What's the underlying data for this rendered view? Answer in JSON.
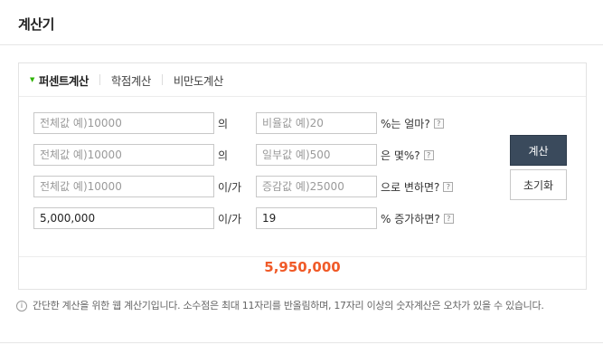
{
  "header": {
    "title": "계산기"
  },
  "tabs": [
    {
      "label": "퍼센트계산",
      "active": true
    },
    {
      "label": "학점계산",
      "active": false
    },
    {
      "label": "비만도계산",
      "active": false
    }
  ],
  "rows": [
    {
      "total_value": "",
      "total_placeholder": "전체값 예)10000",
      "connector": "의",
      "second_value": "",
      "second_placeholder": "비율값 예)20",
      "suffix": "%는 얼마?"
    },
    {
      "total_value": "",
      "total_placeholder": "전체값 예)10000",
      "connector": "의",
      "second_value": "",
      "second_placeholder": "일부값 예)500",
      "suffix": "은 몇%?"
    },
    {
      "total_value": "",
      "total_placeholder": "전체값 예)10000",
      "connector": "이/가",
      "second_value": "",
      "second_placeholder": "증감값 예)25000",
      "suffix": "으로 변하면?"
    },
    {
      "total_value": "5,000,000",
      "total_placeholder": "",
      "connector": "이/가",
      "second_value": "19",
      "second_placeholder": "",
      "suffix": "% 증가하면?"
    }
  ],
  "help_glyph": "?",
  "info_glyph": "i",
  "buttons": {
    "calculate": "계산",
    "reset": "초기화"
  },
  "result": "5,950,000",
  "notice": "간단한 계산을 위한 웹 계산기입니다. 소수점은 최대 11자리를 반올림하며, 17자리 이상의 숫자계산은 오차가 있을 수 있습니다.",
  "colors": {
    "result": "#f05a28",
    "tab_marker": "#2db400",
    "calc_button": "#3a4a5c"
  },
  "icons": {
    "tab_marker": "triangle-down-icon",
    "help": "question-mark-icon",
    "notice": "info-circle-icon"
  }
}
